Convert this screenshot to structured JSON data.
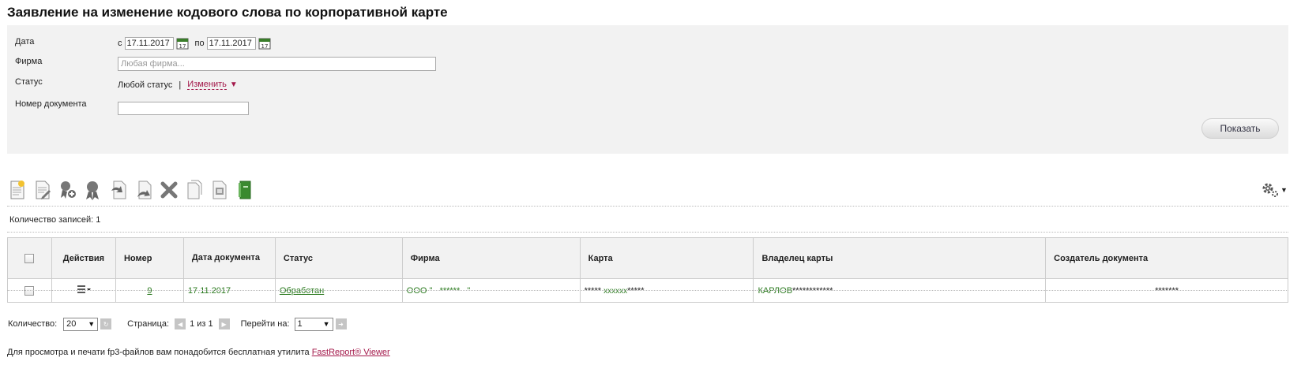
{
  "page": {
    "title": "Заявление на изменение кодового слова по корпоративной карте"
  },
  "filters": {
    "date_label": "Дата",
    "date_from_prefix": "с",
    "date_from": "17.11.2017",
    "date_to_prefix": "по",
    "date_to": "17.11.2017",
    "firm_label": "Фирма",
    "firm_placeholder": "Любая фирма...",
    "status_label": "Статус",
    "status_value": "Любой статус",
    "status_sep": "|",
    "status_change": "Изменить",
    "doc_number_label": "Номер документа",
    "doc_number_value": "",
    "show_button": "Показать"
  },
  "toolbar": {
    "icons": [
      "new-document-icon",
      "edit-document-icon",
      "add-signature-icon",
      "signature-icon",
      "send-document-icon",
      "withdraw-document-icon",
      "delete-icon",
      "copy-icon",
      "print-icon",
      "export-icon"
    ],
    "settings_icon": "gear-icon"
  },
  "records": {
    "count_label": "Количество записей: 1"
  },
  "table": {
    "columns": [
      "Действия",
      "Номер",
      "Дата документа",
      "Статус",
      "Фирма",
      "Карта",
      "Владелец карты",
      "Создатель документа"
    ],
    "rows": [
      {
        "number": "9",
        "date": "17.11.2017",
        "status": "Обработан",
        "firm": "ООО \"   ******   \"",
        "card_prefix": "*****",
        "card_mid": "хххххх",
        "card_suffix": "*****",
        "owner_name": "КАРЛОВ",
        "owner_mask": "************",
        "creator": "*******"
      }
    ]
  },
  "pager": {
    "qty_label": "Количество:",
    "qty_value": "20",
    "page_label": "Страница:",
    "page_info": "1 из 1",
    "goto_label": "Перейти на:",
    "goto_value": "1"
  },
  "footer": {
    "text": "Для просмотра и печати fp3-файлов вам понадобится бесплатная утилита",
    "link": "FastReport® Viewer"
  },
  "colors": {
    "accent_link": "#a3184a",
    "green_text": "#2b7a1f",
    "panel_bg": "#f2f2f2"
  }
}
